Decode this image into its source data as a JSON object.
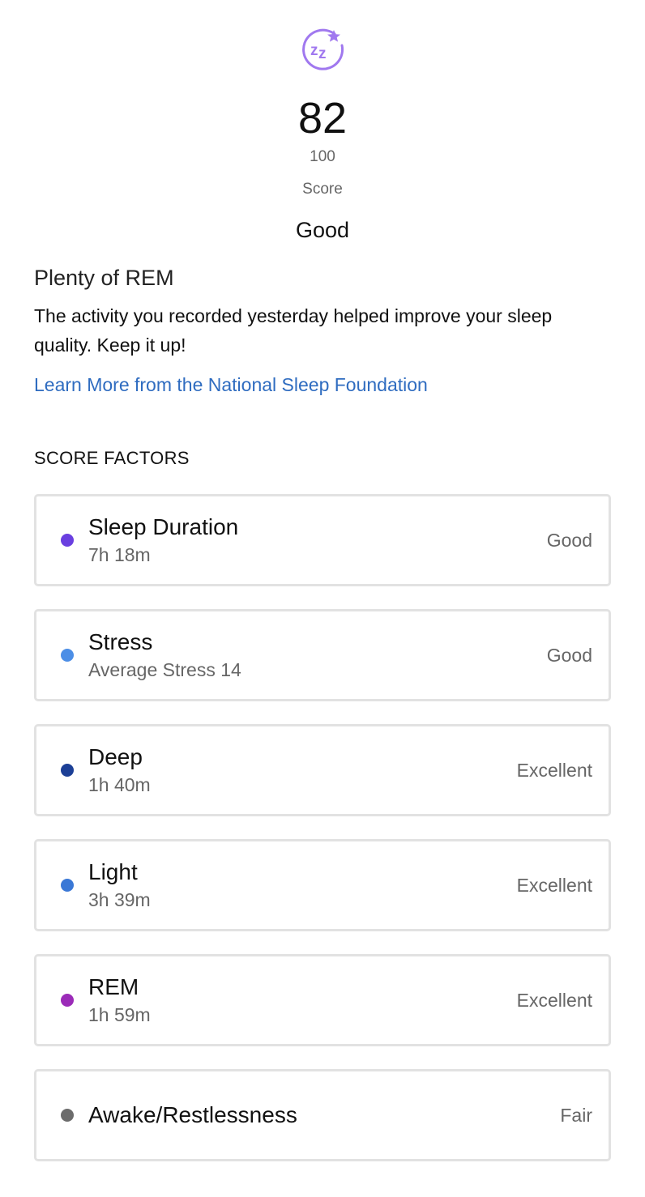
{
  "score": {
    "value": "82",
    "max": "100",
    "label": "Score",
    "quality": "Good",
    "icon": "sleep-zz-icon",
    "icon_color": "#a078ef"
  },
  "insight": {
    "title": "Plenty of REM",
    "body": "The activity you recorded yesterday helped improve your sleep quality. Keep it up!",
    "link_text": "Learn More from the National Sleep Foundation",
    "link_color": "#2f6cc0"
  },
  "factors": {
    "heading": "SCORE FACTORS",
    "items": [
      {
        "name": "Sleep Duration",
        "detail": "7h 18m",
        "rating": "Good",
        "color": "#6a3fe0"
      },
      {
        "name": "Stress",
        "detail": "Average Stress 14",
        "rating": "Good",
        "color": "#4c8ee6"
      },
      {
        "name": "Deep",
        "detail": "1h 40m",
        "rating": "Excellent",
        "color": "#1c3f96"
      },
      {
        "name": "Light",
        "detail": "3h 39m",
        "rating": "Excellent",
        "color": "#3a78d6"
      },
      {
        "name": "REM",
        "detail": "1h 59m",
        "rating": "Excellent",
        "color": "#9b2bb8"
      },
      {
        "name": "Awake/Restlessness",
        "detail": "",
        "rating": "Fair",
        "color": "#6c6c6c"
      }
    ]
  }
}
